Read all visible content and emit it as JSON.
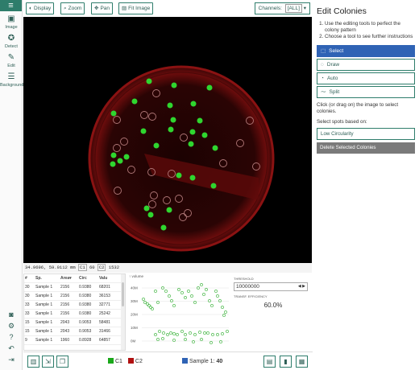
{
  "nav": {
    "items": [
      {
        "label": "Image",
        "icon": "image-icon"
      },
      {
        "label": "Detect",
        "icon": "detect-icon"
      },
      {
        "label": "Edit",
        "icon": "edit-icon"
      },
      {
        "label": "Background",
        "icon": "background-icon"
      }
    ]
  },
  "toolbar": {
    "display": "Display",
    "zoom": "Zoom",
    "pan": "Pan",
    "fit": "Fit Image",
    "channels_label": "Channels:",
    "channels_value": "[ALL]"
  },
  "coords": {
    "pos": "34.9696, 59.0112 mm",
    "c1": "C1",
    "c1_val": "60",
    "c2": "C2",
    "c2_val": "1532"
  },
  "table": {
    "headers": [
      "#",
      "Sp.",
      "Area",
      "Circ",
      "Valu"
    ],
    "rows": [
      [
        "30",
        "Sample 1",
        "2156",
        "0.9380",
        "68201"
      ],
      [
        "30",
        "Sample 1",
        "2156",
        "0.9380",
        "36153"
      ],
      [
        "33",
        "Sample 1",
        "2156",
        "0.9380",
        "32771"
      ],
      [
        "33",
        "Sample 1",
        "2156",
        "0.9380",
        "25242"
      ],
      [
        "15",
        "Sample 1",
        "2043",
        "0.9053",
        "58481"
      ],
      [
        "15",
        "Sample 1",
        "2043",
        "0.9053",
        "31466"
      ],
      [
        "9",
        "Sample 1",
        "1960",
        "0.8928",
        "64857"
      ]
    ]
  },
  "plot": {
    "title": "↑ volume",
    "ticks": [
      "40M",
      "30M",
      "20M",
      "10M",
      "0M"
    ]
  },
  "threshold": {
    "label": "THRESHOLD",
    "value": "10000000",
    "te_label": "TRANSF. EFFICIENCY",
    "efficiency": "60.0%"
  },
  "legend": {
    "c1": "C1",
    "c2": "C2",
    "c1_color": "#1aa81a",
    "c2_color": "#b01010",
    "sample_label": "Sample 1:",
    "sample_count": "40",
    "sample_color": "#2f63b5"
  },
  "panel": {
    "title": "Edit Colonies",
    "instructions": [
      "Use the editing tools to perfect the colony pattern",
      "Choose a tool to see further instructions"
    ],
    "tools": [
      {
        "label": "Select",
        "icon": "cursor-icon"
      },
      {
        "label": "Draw",
        "icon": "draw-icon"
      },
      {
        "label": "Auto",
        "icon": "auto-icon"
      },
      {
        "label": "Split",
        "icon": "split-icon"
      }
    ],
    "click_text": "Click (or drag on) the image to select colonies.",
    "select_spots_label": "Select spots based on:",
    "low_circularity": "Low Circularity",
    "delete_button": "Delete Selected Colonies"
  },
  "accent_color": "#2e7d6b",
  "active_color": "#2f63b5"
}
